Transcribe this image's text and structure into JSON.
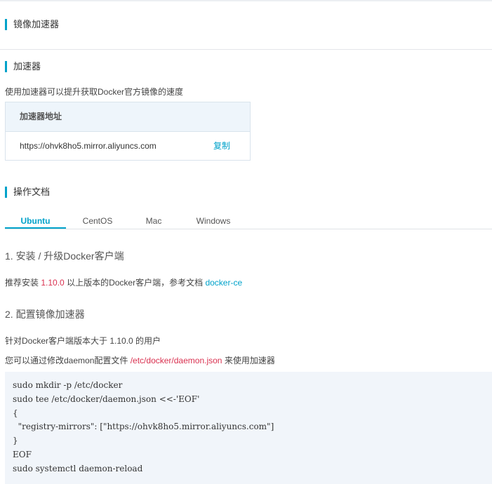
{
  "title": "镜像加速器",
  "accelerator": {
    "section_title": "加速器",
    "description": "使用加速器可以提升获取Docker官方镜像的速度",
    "box_header": "加速器地址",
    "url": "https://ohvk8ho5.mirror.aliyuncs.com",
    "copy_label": "复制"
  },
  "docs": {
    "section_title": "操作文档",
    "tabs": [
      "Ubuntu",
      "CentOS",
      "Mac",
      "Windows"
    ],
    "active_tab": "Ubuntu",
    "step1": {
      "title": "1. 安装 / 升级Docker客户端",
      "text_pre": "推荐安装",
      "version": "1.10.0",
      "text_mid": "以上版本的Docker客户端，参考文档",
      "link": "docker-ce"
    },
    "step2": {
      "title": "2. 配置镜像加速器",
      "line1": "针对Docker客户端版本大于 1.10.0 的用户",
      "line2_pre": "您可以通过修改daemon配置文件",
      "path": "/etc/docker/daemon.json",
      "line2_post": "来使用加速器"
    },
    "code_lines": [
      "sudo mkdir -p /etc/docker",
      "sudo tee /etc/docker/daemon.json <<-'EOF'",
      "{",
      "  \"registry-mirrors\": [\"https://ohvk8ho5.mirror.aliyuncs.com\"]",
      "}",
      "EOF",
      "sudo systemctl daemon-reload"
    ]
  },
  "colors": {
    "accent": "#00a2ca",
    "highlight": "#d9304f",
    "code_bg": "#f1f5fa"
  }
}
